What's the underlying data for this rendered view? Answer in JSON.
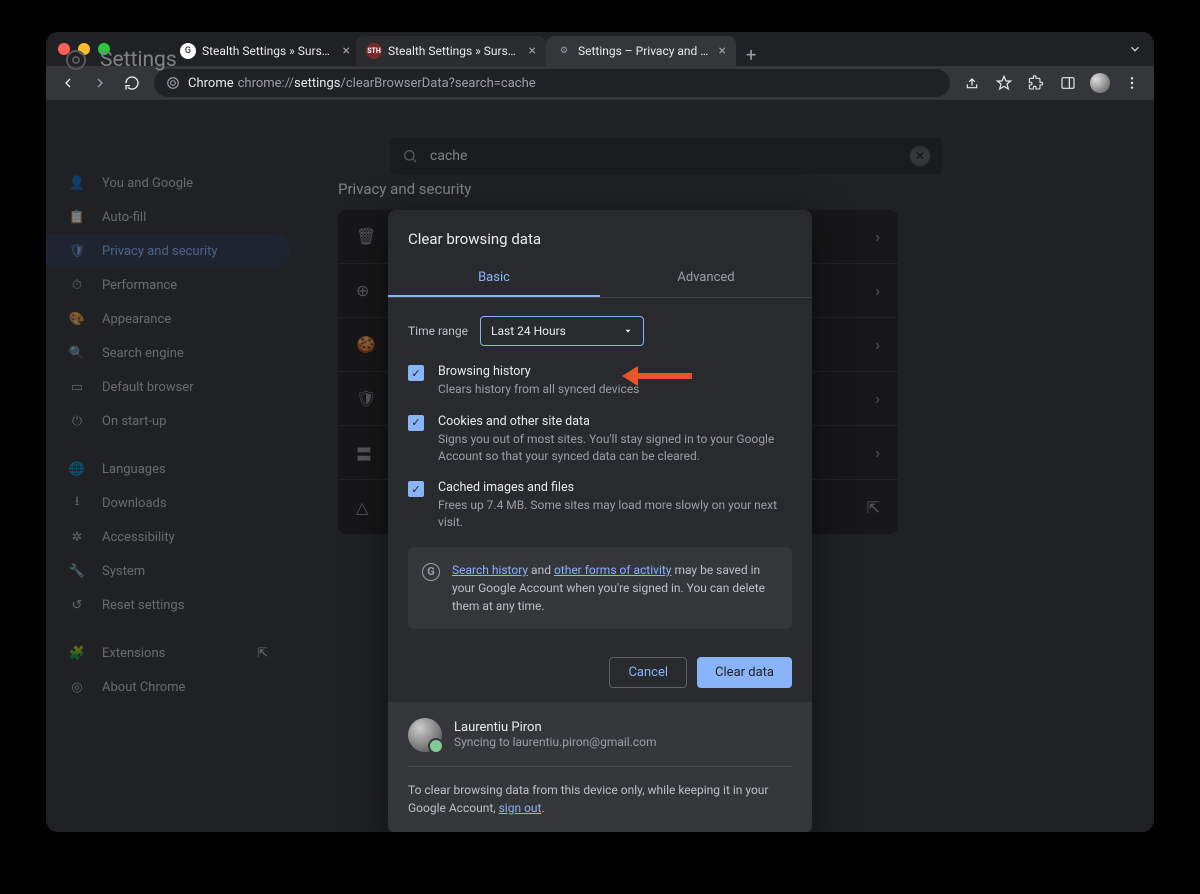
{
  "window": {
    "tabs": [
      {
        "label": "Stealth Settings » Sursa de tut"
      },
      {
        "label": "Settings – Privacy and security"
      }
    ]
  },
  "toolbar": {
    "browser_label": "Chrome",
    "url_prefix": "chrome://",
    "url_hl": "settings",
    "url_suffix": "/clearBrowserData?search=cache"
  },
  "settings": {
    "title": "Settings",
    "search_value": "cache",
    "nav": [
      "You and Google",
      "Auto-fill",
      "Privacy and security",
      "Performance",
      "Appearance",
      "Search engine",
      "Default browser",
      "On start-up",
      "Languages",
      "Downloads",
      "Accessibility",
      "System",
      "Reset settings",
      "Extensions",
      "About Chrome"
    ],
    "breadcrumb": "Privacy and security"
  },
  "dialog": {
    "title": "Clear browsing data",
    "tab_basic": "Basic",
    "tab_advanced": "Advanced",
    "time_range_label": "Time range",
    "time_range_value": "Last 24 Hours",
    "items": [
      {
        "title": "Browsing history",
        "desc": "Clears history from all synced devices"
      },
      {
        "title": "Cookies and other site data",
        "desc": "Signs you out of most sites. You'll stay signed in to your Google Account so that your synced data can be cleared."
      },
      {
        "title": "Cached images and files",
        "desc": "Frees up 7.4 MB. Some sites may load more slowly on your next visit."
      }
    ],
    "info_link1": "Search history",
    "info_mid1": " and ",
    "info_link2": "other forms of activity",
    "info_rest": " may be saved in your Google Account when you're signed in. You can delete them at any time.",
    "cancel": "Cancel",
    "clear": "Clear data",
    "user_name": "Laurentiu Piron",
    "user_sync": "Syncing to laurentiu.piron@gmail.com",
    "signout_pre": "To clear browsing data from this device only, while keeping it in your Google Account, ",
    "signout_link": "sign out",
    "signout_post": "."
  }
}
